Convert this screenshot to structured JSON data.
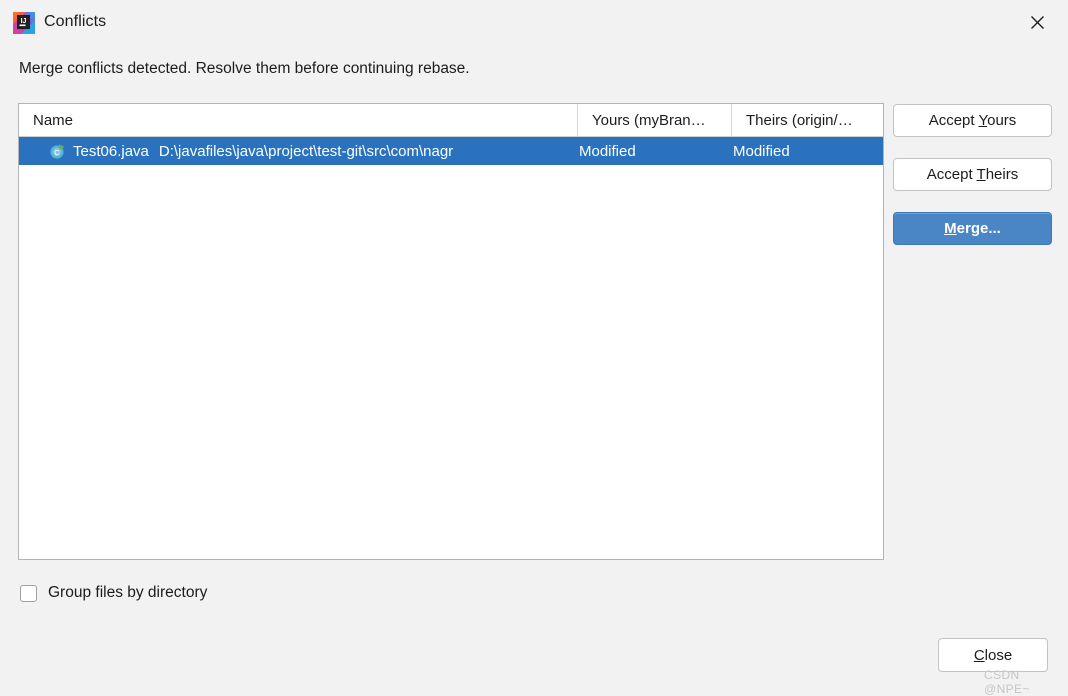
{
  "window": {
    "title": "Conflicts",
    "app_icon": "intellij-idea-logo",
    "close_icon": "close-icon"
  },
  "message": "Merge conflicts detected. Resolve them before continuing rebase.",
  "table": {
    "columns": [
      {
        "id": "name",
        "label": "Name"
      },
      {
        "id": "yours",
        "label": "Yours (myBran…"
      },
      {
        "id": "theirs",
        "label": "Theirs (origin/…"
      }
    ],
    "rows": [
      {
        "icon": "java-class-icon",
        "file_name": "Test06.java",
        "file_path": "D:\\javafiles\\java\\project\\test-git\\src\\com\\nagr",
        "yours": "Modified",
        "theirs": "Modified",
        "selected": true
      }
    ]
  },
  "side_buttons": [
    {
      "id": "accept-yours",
      "label_before": "Accept ",
      "mnemonic": "Y",
      "label_after": "ours",
      "primary": false
    },
    {
      "id": "accept-theirs",
      "label_before": "Accept ",
      "mnemonic": "T",
      "label_after": "heirs",
      "primary": false
    },
    {
      "id": "merge",
      "label_before": "",
      "mnemonic": "M",
      "label_after": "erge...",
      "primary": true
    }
  ],
  "checkbox": {
    "label": "Group files by directory",
    "checked": false
  },
  "close_button": {
    "label_before": "",
    "mnemonic": "C",
    "label_after": "lose"
  },
  "watermark": "CSDN @NPE~",
  "colors": {
    "dialog_bg": "#f2f2f2",
    "selection_blue": "#2a72bd",
    "primary_button": "#4a86c5",
    "table_bg": "#ffffff",
    "border": "#b4b4b4"
  }
}
